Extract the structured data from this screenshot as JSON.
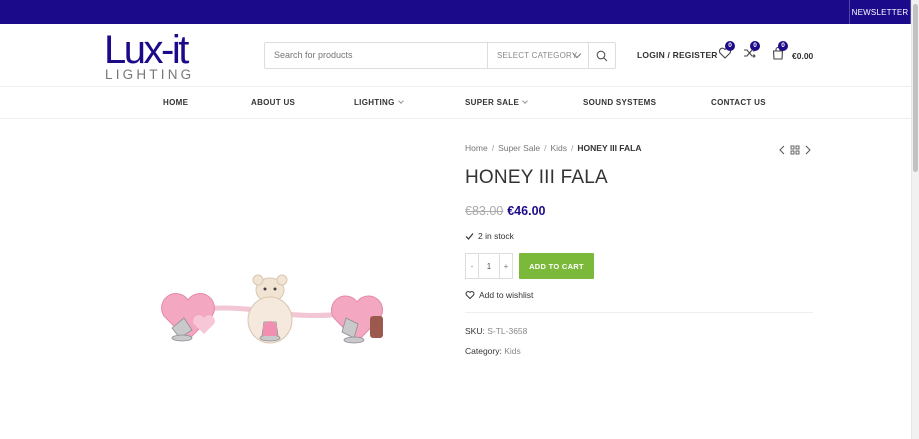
{
  "colors": {
    "brand": "#1b0a8a",
    "addToCart": "#7bb93b"
  },
  "topbar": {
    "newsletter": "NEWSLETTER"
  },
  "logo": {
    "brand": "Lux-it",
    "sub": "LIGHTING"
  },
  "search": {
    "placeholder": "Search for products",
    "category": "SELECT CATEGORY",
    "icon": "search-icon"
  },
  "header": {
    "login": "LOGIN / REGISTER",
    "wishlist_count": "0",
    "compare_count": "0",
    "cart_count": "0",
    "cart_total": "€0.00"
  },
  "nav": {
    "items": [
      {
        "label": "HOME"
      },
      {
        "label": "ABOUT US"
      },
      {
        "label": "LIGHTING"
      },
      {
        "label": "SUPER SALE"
      },
      {
        "label": "SOUND SYSTEMS"
      },
      {
        "label": "CONTACT US"
      }
    ]
  },
  "breadcrumb": {
    "home": "Home",
    "sale": "Super Sale",
    "kids": "Kids",
    "current": "HONEY III FALA"
  },
  "product": {
    "title": "HONEY III FALA",
    "old_price": "€83.00",
    "price": "€46.00",
    "stock": "2 in stock",
    "qty_minus": "-",
    "qty": "1",
    "qty_plus": "+",
    "add_to_cart": "ADD TO CART",
    "wishlist": "Add to wishlist",
    "sku_label": "SKU:",
    "sku": "S-TL-3658",
    "category_label": "Category:",
    "category": "Kids"
  }
}
